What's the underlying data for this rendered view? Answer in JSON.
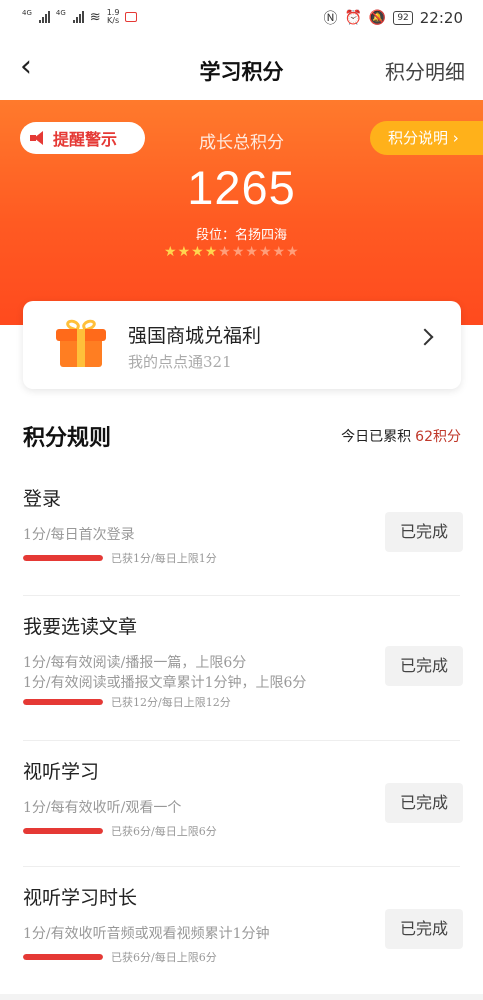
{
  "status_bar": {
    "signal1_label": "4G",
    "signal2_label": "4G",
    "net_speed_value": "1.9",
    "net_speed_unit": "K/s",
    "battery": "92",
    "time": "22:20"
  },
  "nav": {
    "title": "学习积分",
    "right_label": "积分明细"
  },
  "hero": {
    "alert_label": "提醒警示",
    "explain_label": "积分说明 ›",
    "total_label": "成长总积分",
    "total_score": "1265",
    "rank_text": "段位：名扬四海",
    "stars_filled": 4,
    "stars_total": 10
  },
  "mall": {
    "title": "强国商城兑福利",
    "subtitle": "我的点点通321"
  },
  "rules": {
    "title": "积分规则",
    "today_label": "今日已累积",
    "today_points": "62积分"
  },
  "tasks": [
    {
      "title": "登录",
      "desc": [
        "1分/每日首次登录"
      ],
      "progress_text": "已获1分/每日上限1分",
      "progress": 1.0,
      "status": "已完成"
    },
    {
      "title": "我要选读文章",
      "desc": [
        "1分/每有效阅读/播报一篇，上限6分",
        "1分/有效阅读或播报文章累计1分钟，上限6分"
      ],
      "progress_text": "已获12分/每日上限12分",
      "progress": 1.0,
      "status": "已完成"
    },
    {
      "title": "视听学习",
      "desc": [
        "1分/每有效收听/观看一个"
      ],
      "progress_text": "已获6分/每日上限6分",
      "progress": 1.0,
      "status": "已完成"
    },
    {
      "title": "视听学习时长",
      "desc": [
        "1分/有效收听音频或观看视频累计1分钟"
      ],
      "progress_text": "已获6分/每日上限6分",
      "progress": 1.0,
      "status": "已完成"
    }
  ],
  "colors": {
    "brand_orange": "#ff5a22",
    "accent_yellow": "#ffb11a",
    "progress_red": "#e53935",
    "points_red": "#c0392b"
  }
}
